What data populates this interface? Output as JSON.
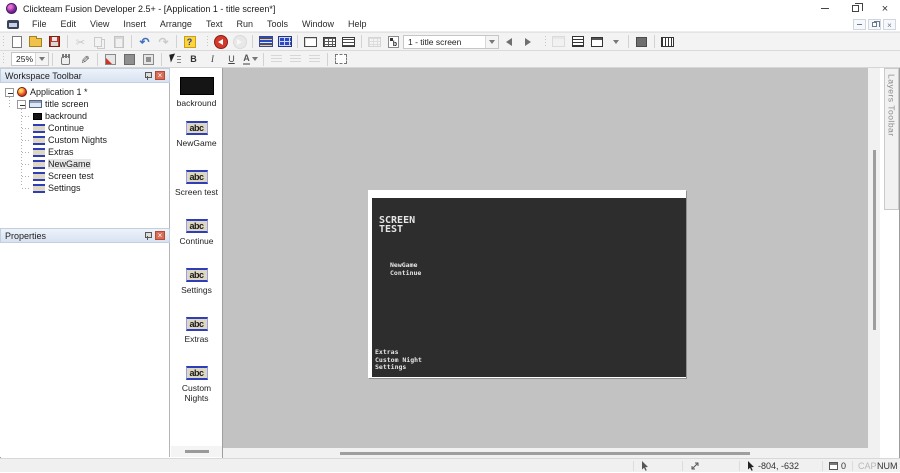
{
  "window": {
    "title": "Clickteam Fusion Developer 2.5+ - [Application 1 - title screen*]"
  },
  "menu": {
    "items": [
      "File",
      "Edit",
      "View",
      "Insert",
      "Arrange",
      "Text",
      "Run",
      "Tools",
      "Window",
      "Help"
    ]
  },
  "toolbar": {
    "frame_selector": "1 - title screen",
    "zoom_level": "25%",
    "bold_label": "B",
    "italic_label": "I",
    "underline_label": "U",
    "font_color_label": "A"
  },
  "workspace_panel": {
    "title": "Workspace Toolbar",
    "application_label": "Application 1 *",
    "frame_label": "title screen",
    "objects": [
      "backround",
      "Continue",
      "Custom Nights",
      "Extras",
      "NewGame",
      "Screen test",
      "Settings"
    ]
  },
  "properties_panel": {
    "title": "Properties"
  },
  "objects_panel": {
    "string_icon_text": "abc",
    "items": [
      {
        "label": "backround"
      },
      {
        "label": "NewGame"
      },
      {
        "label": "Screen test"
      },
      {
        "label": "Continue"
      },
      {
        "label": "Settings"
      },
      {
        "label": "Extras"
      },
      {
        "label": "Custom Nights"
      }
    ]
  },
  "frame_canvas": {
    "title_line1": "SCREEN",
    "title_line2": "TEST",
    "menu_top": [
      "NewGame",
      "Continue"
    ],
    "menu_bottom": [
      "Extras",
      "Custom Night",
      "Settings"
    ]
  },
  "layers_panel": {
    "title": "Layers Toolbar"
  },
  "status_bar": {
    "coordinates": "-804, -632",
    "object_count": "0",
    "caps_indicator": "CAP",
    "num_indicator": "NUM"
  },
  "colors": {
    "panel_header": "#dce6f3",
    "frame_background": "#2d2d2d",
    "canvas_background": "#c2c2c2",
    "close_badge": "#dd6a54",
    "save_red": "#c0392b",
    "editor_blue": "#2b49c0"
  }
}
